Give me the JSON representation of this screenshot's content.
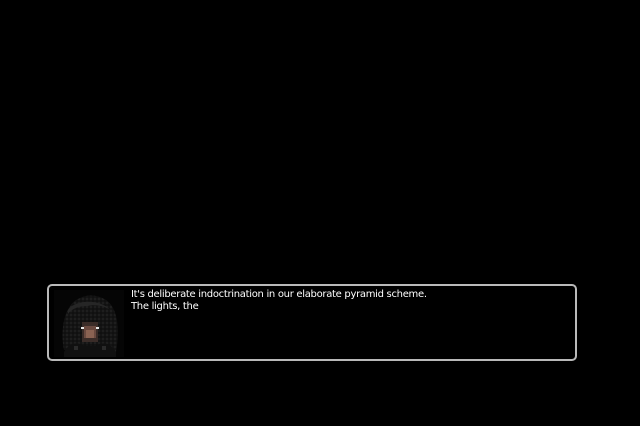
{
  "dialogue": {
    "lines": [
      "It's deliberate indoctrination in our elaborate pyramid scheme.",
      "The lights, the"
    ]
  },
  "portrait": {
    "icon": "hooded-character-portrait-icon"
  },
  "colors": {
    "background": "#000000",
    "box_border": "#b9b9b9",
    "text": "#ffffff"
  }
}
